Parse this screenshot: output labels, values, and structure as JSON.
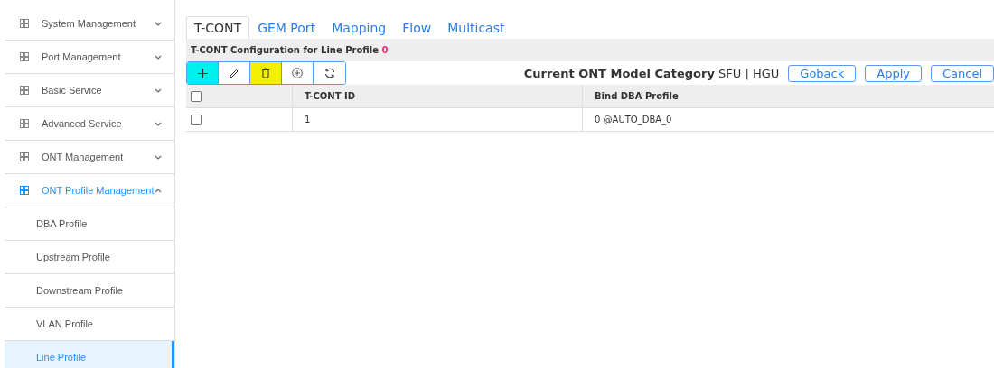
{
  "sidebar": {
    "items": [
      {
        "label": "System Management",
        "expanded": false,
        "selected": false
      },
      {
        "label": "Port Management",
        "expanded": false,
        "selected": false
      },
      {
        "label": "Basic Service",
        "expanded": false,
        "selected": false
      },
      {
        "label": "Advanced Service",
        "expanded": false,
        "selected": false
      },
      {
        "label": "ONT Management",
        "expanded": false,
        "selected": false
      },
      {
        "label": "ONT Profile Management",
        "expanded": true,
        "selected": true,
        "children": [
          {
            "label": "DBA Profile",
            "selected": false
          },
          {
            "label": "Upstream Profile",
            "selected": false
          },
          {
            "label": "Downstream Profile",
            "selected": false
          },
          {
            "label": "VLAN Profile",
            "selected": false
          },
          {
            "label": "Line Profile",
            "selected": true
          }
        ]
      }
    ]
  },
  "tabs": [
    {
      "label": "T-CONT",
      "selected": true
    },
    {
      "label": "GEM Port",
      "selected": false
    },
    {
      "label": "Mapping",
      "selected": false
    },
    {
      "label": "Flow",
      "selected": false
    },
    {
      "label": "Multicast",
      "selected": false
    }
  ],
  "panel": {
    "title": "T-CONT Configuration for Line Profile",
    "profile_id": "0"
  },
  "toolbar": {
    "buttons": [
      {
        "kind": "add",
        "color": "#00f0f0"
      },
      {
        "kind": "edit",
        "color": "#ffffff"
      },
      {
        "kind": "delete",
        "color": "#f0f000"
      },
      {
        "kind": "add-circle",
        "color": "#ffffff"
      },
      {
        "kind": "refresh",
        "color": "#ffffff"
      }
    ],
    "category": "**Current ONT Model Category** SFU | HGU",
    "actions": [
      "Goback",
      "Apply",
      "Cancel"
    ]
  },
  "table": {
    "columns": [
      "T-CONT ID",
      "Bind DBA Profile"
    ],
    "header_checked": false,
    "rows": [
      {
        "checked": false,
        "cells": [
          "1",
          "0 @AUTO_DBA_0"
        ]
      }
    ]
  }
}
